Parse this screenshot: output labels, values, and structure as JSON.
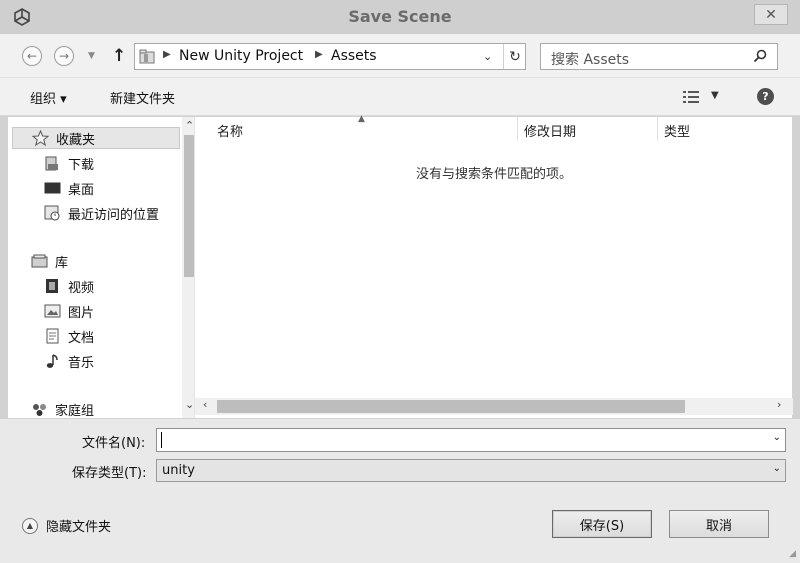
{
  "window": {
    "title": "Save Scene",
    "close_glyph": "✕"
  },
  "nav": {
    "breadcrumbs": [
      "New Unity Project",
      "Assets"
    ],
    "search_placeholder": "搜索 Assets"
  },
  "toolbar": {
    "organize": "组织 ▾",
    "new_folder": "新建文件夹",
    "help": "?"
  },
  "sidebar": {
    "favorites": "收藏夹",
    "favorites_items": [
      "下载",
      "桌面",
      "最近访问的位置"
    ],
    "libraries": "库",
    "libraries_items": [
      "视频",
      "图片",
      "文档",
      "音乐"
    ],
    "homegroup": "家庭组"
  },
  "file_list": {
    "columns": [
      "名称",
      "修改日期",
      "类型"
    ],
    "empty_message": "没有与搜索条件匹配的项。"
  },
  "form": {
    "filename_label": "文件名(N):",
    "filename_value": "",
    "filetype_label": "保存类型(T):",
    "filetype_value": "unity"
  },
  "footer": {
    "hide_folders": "隐藏文件夹",
    "save": "保存(S)",
    "cancel": "取消"
  }
}
